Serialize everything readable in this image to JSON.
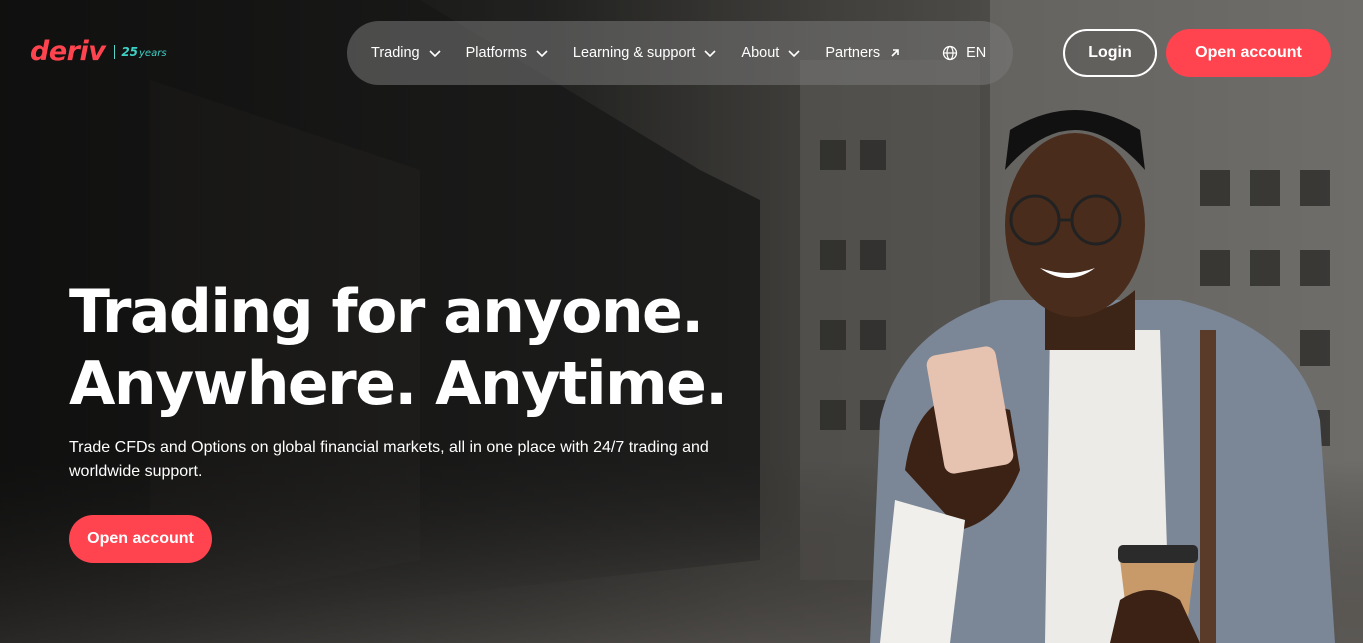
{
  "brand": {
    "logo_text": "deriv",
    "years_number": "25",
    "years_label": "years"
  },
  "nav": {
    "items": [
      {
        "label": "Trading"
      },
      {
        "label": "Platforms"
      },
      {
        "label": "Learning & support"
      },
      {
        "label": "About"
      }
    ],
    "partners_label": "Partners",
    "language": "EN"
  },
  "header": {
    "login_label": "Login",
    "open_account_label": "Open account"
  },
  "hero": {
    "headline_line1": "Trading for anyone.",
    "headline_line2": "Anywhere. Anytime.",
    "subtext": "Trade CFDs and Options on global financial markets, all in one place with 24/7 trading and worldwide support.",
    "cta_label": "Open account"
  },
  "colors": {
    "brand_red": "#ff444f",
    "accent_teal": "#3dd1c6"
  },
  "icons": [
    "chevron-down-icon",
    "arrow-up-right-icon",
    "globe-icon"
  ]
}
